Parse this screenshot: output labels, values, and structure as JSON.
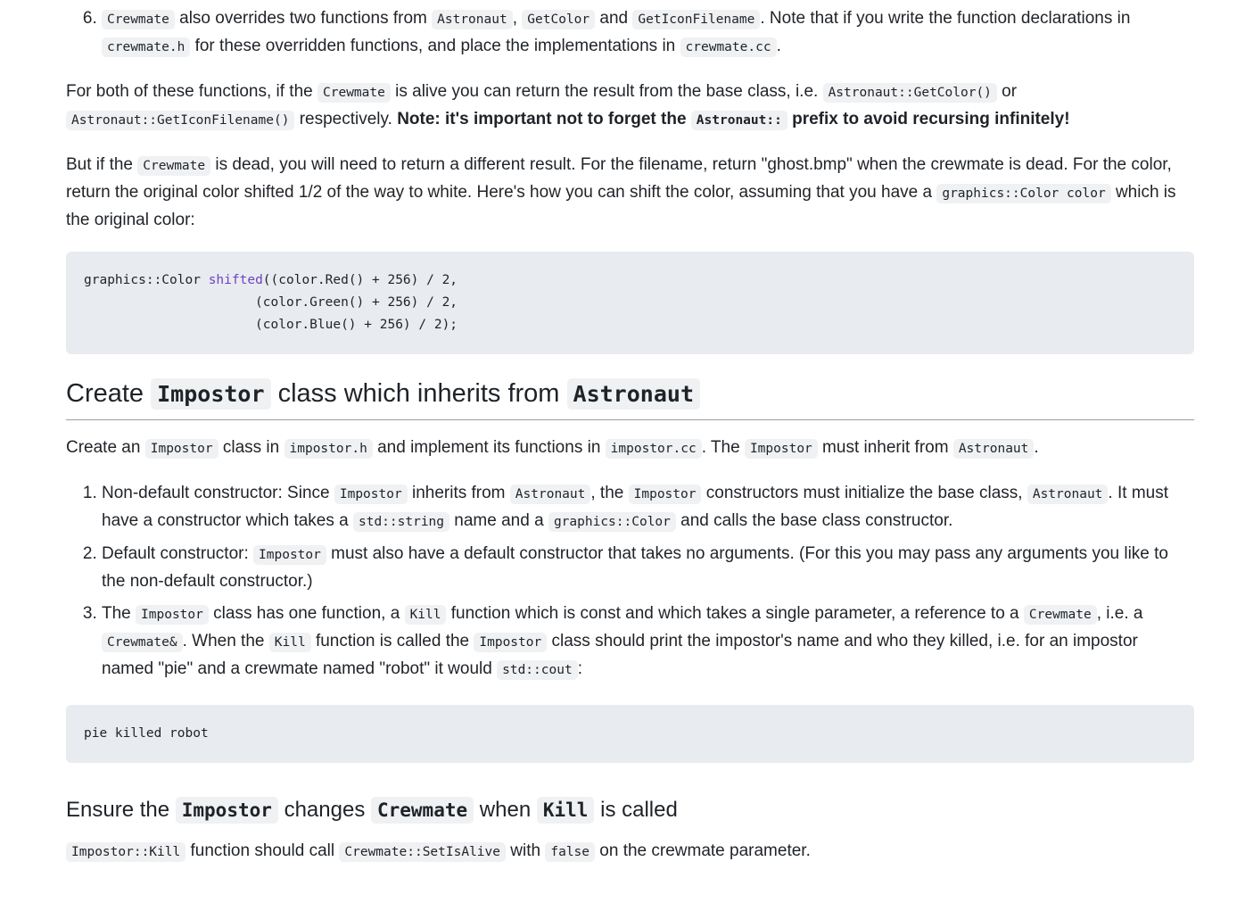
{
  "step6": {
    "number": 6,
    "c1": "Crewmate",
    "t1": " also overrides two functions from ",
    "c2": "Astronaut",
    "t2": ", ",
    "c3": "GetColor",
    "t3": " and ",
    "c4": "GetIconFilename",
    "t4": ". Note that if you write the function declarations in ",
    "c5": "crewmate.h",
    "t5": " for these overridden functions, and place the implementations in ",
    "c6": "crewmate.cc",
    "t6": "."
  },
  "para1": {
    "t1": "For both of these functions, if the ",
    "c1": "Crewmate",
    "t2": " is alive you can return the result from the base class, i.e. ",
    "c2": "Astronaut::GetColor()",
    "t3": " or ",
    "c3": "Astronaut::GetIconFilename()",
    "t4": " respectively. ",
    "b1": "Note: it's important not to forget the ",
    "bc1": "Astronaut::",
    "b2": " prefix to avoid recursing infinitely!"
  },
  "para2": {
    "t1": "But if the ",
    "c1": "Crewmate",
    "t2": " is dead, you will need to return a different result. For the filename, return \"ghost.bmp\" when the crewmate is dead. For the color, return the original color shifted 1/2 of the way to white. Here's how you can shift the color, assuming that you have a ",
    "c2": "graphics::Color color",
    "t3": " which is the original color:"
  },
  "code1": {
    "l1a": "graphics::Color ",
    "l1fn": "shifted",
    "l1b": "((color.Red() + 256) / 2,",
    "l2": "                      (color.Green() + 256) / 2,",
    "l3": "                      (color.Blue() + 256) / 2);"
  },
  "heading1": {
    "t1": "Create ",
    "c1": "Impostor",
    "t2": " class which inherits from ",
    "c2": "Astronaut"
  },
  "para3": {
    "t1": "Create an ",
    "c1": "Impostor",
    "t2": " class in ",
    "c2": "impostor.h",
    "t3": " and implement its functions in ",
    "c3": "impostor.cc",
    "t4": ". The ",
    "c4": "Impostor",
    "t5": " must inherit from ",
    "c5": "Astronaut",
    "t6": "."
  },
  "list": [
    {
      "t1": "Non-default constructor: Since ",
      "c1": "Impostor",
      "t2": " inherits from ",
      "c2": "Astronaut",
      "t3": ", the ",
      "c3": "Impostor",
      "t4": " constructors must initialize the base class, ",
      "c4": "Astronaut",
      "t5": ". It must have a constructor which takes a ",
      "c5": "std::string",
      "t6": " name and a ",
      "c6": "graphics::Color",
      "t7": " and calls the base class constructor."
    },
    {
      "t1": "Default constructor: ",
      "c1": "Impostor",
      "t2": " must also have a default constructor that takes no arguments. (For this you may pass any arguments you like to the non-default constructor.)"
    },
    {
      "t1": "The ",
      "c1": "Impostor",
      "t2": " class has one function, a ",
      "c2": "Kill",
      "t3": " function which is const and which takes a single parameter, a reference to a ",
      "c3": "Crewmate",
      "t4": ", i.e. a ",
      "c4": "Crewmate&",
      "t5": ". When the ",
      "c5": "Kill",
      "t6": " function is called the ",
      "c6": "Impostor",
      "t7": " class should print the impostor's name and who they killed, i.e. for an impostor named \"pie\" and a crewmate named \"robot\" it would ",
      "c7": "std::cout",
      "t8": ":"
    }
  ],
  "code2": {
    "l1": "pie killed robot"
  },
  "heading2": {
    "t1": "Ensure the ",
    "c1": "Impostor",
    "t2": " changes ",
    "c2": "Crewmate",
    "t3": " when ",
    "c3": "Kill",
    "t4": " is called"
  },
  "para4": {
    "c1": "Impostor::Kill",
    "t1": " function should call ",
    "c2": "Crewmate::SetIsAlive",
    "t2": " with ",
    "c3": "false",
    "t3": " on the crewmate parameter."
  }
}
